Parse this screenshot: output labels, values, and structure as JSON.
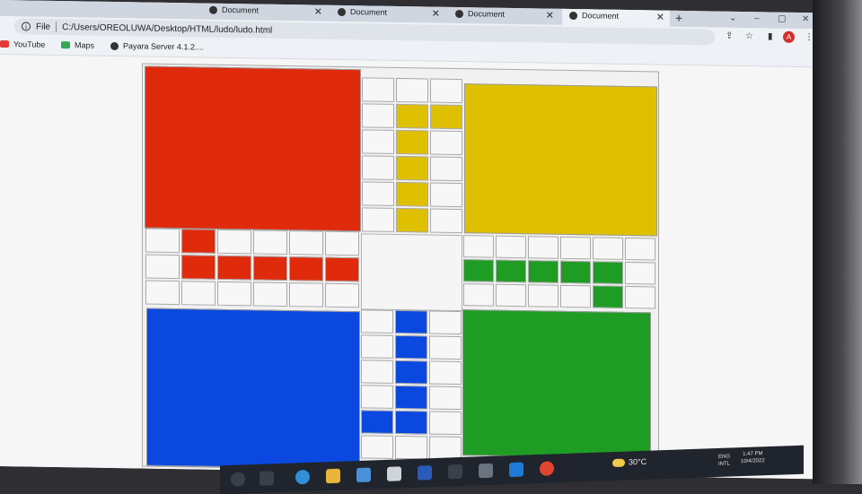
{
  "browser": {
    "tabs": [
      {
        "label": "Document",
        "active": false
      },
      {
        "label": "Document",
        "active": false
      },
      {
        "label": "Document",
        "active": false
      },
      {
        "label": "Document",
        "active": true
      }
    ],
    "new_tab": "+",
    "address": {
      "scheme_label": "File",
      "url": "C:/Users/OREOLUWA/Desktop/HTML/ludo/ludo.html"
    },
    "bookmarks": [
      {
        "label": "YouTube",
        "icon": "youtube-icon",
        "color": "#e53935"
      },
      {
        "label": "Maps",
        "icon": "maps-icon",
        "color": "#34a853"
      },
      {
        "label": "Payara Server 4.1.2....",
        "icon": "globe-icon",
        "color": "#333333"
      }
    ],
    "profile_initial": "A"
  },
  "board": {
    "colors": {
      "red": "#e02a0c",
      "yellow": "#dfc000",
      "blue": "#0a48e0",
      "green": "#1f9c24",
      "empty": "#f7f7f7"
    },
    "homes": [
      "red",
      "yellow",
      "blue",
      "green"
    ],
    "top_arm": [
      [
        "empty",
        "empty",
        "empty"
      ],
      [
        "empty",
        "yellow",
        "yellow"
      ],
      [
        "empty",
        "yellow",
        "empty"
      ],
      [
        "empty",
        "yellow",
        "empty"
      ],
      [
        "empty",
        "yellow",
        "empty"
      ],
      [
        "empty",
        "yellow",
        "empty"
      ]
    ],
    "left_arm": [
      [
        "empty",
        "red",
        "empty",
        "empty",
        "empty",
        "empty"
      ],
      [
        "empty",
        "red",
        "red",
        "red",
        "red",
        "red"
      ],
      [
        "empty",
        "empty",
        "empty",
        "empty",
        "empty",
        "empty"
      ]
    ],
    "right_arm": [
      [
        "empty",
        "empty",
        "empty",
        "empty",
        "empty",
        "empty"
      ],
      [
        "green",
        "green",
        "green",
        "green",
        "green",
        "empty"
      ],
      [
        "empty",
        "empty",
        "empty",
        "empty",
        "green",
        "empty"
      ]
    ],
    "bottom_arm": [
      [
        "empty",
        "blue",
        "empty"
      ],
      [
        "empty",
        "blue",
        "empty"
      ],
      [
        "empty",
        "blue",
        "empty"
      ],
      [
        "empty",
        "blue",
        "empty"
      ],
      [
        "blue",
        "blue",
        "empty"
      ],
      [
        "empty",
        "empty",
        "empty"
      ]
    ]
  },
  "taskbar": {
    "weather": "30°C",
    "lang": "ENG",
    "region": "INTL",
    "time": "1:47 PM",
    "date": "10/4/2022"
  }
}
